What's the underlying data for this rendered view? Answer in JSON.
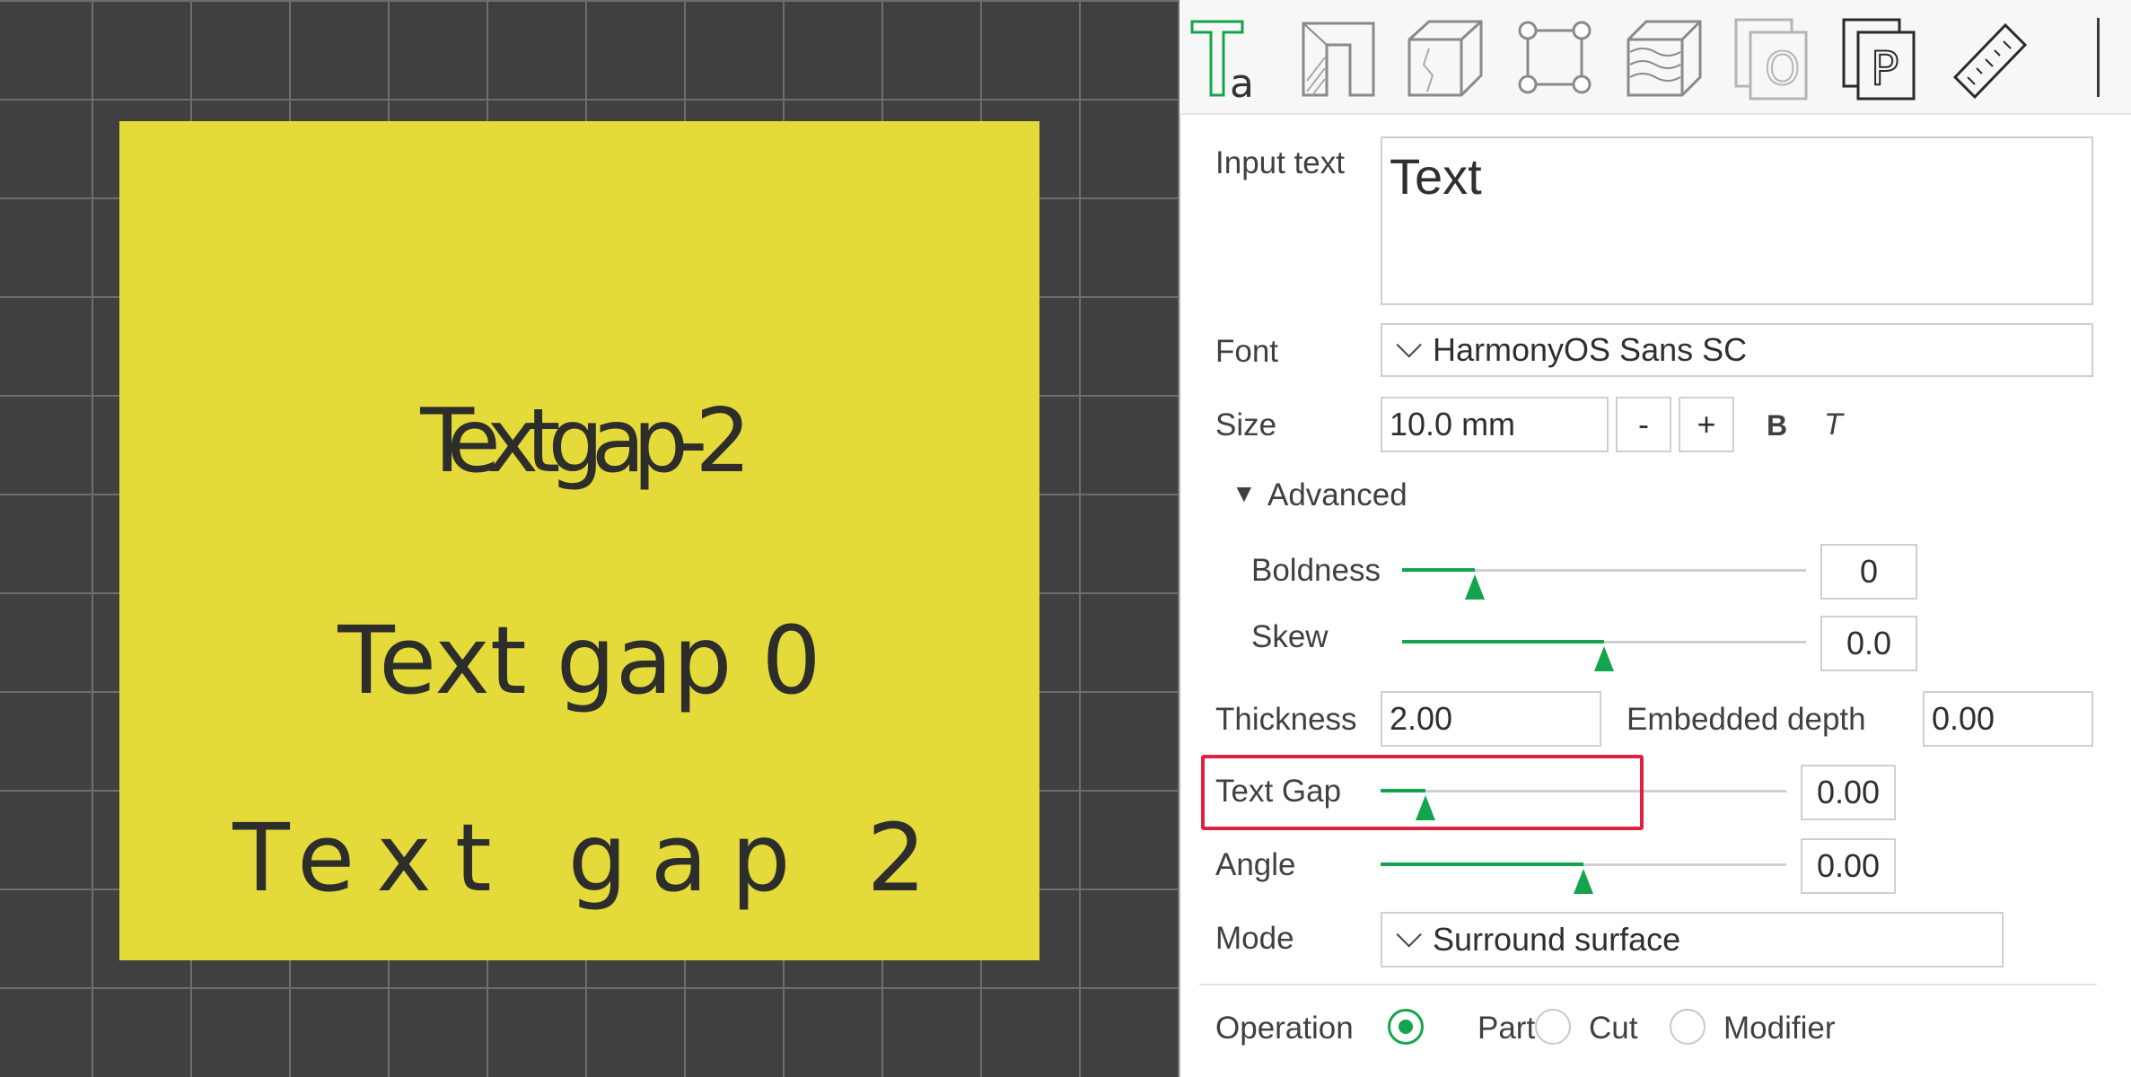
{
  "viewport": {
    "plate_color": "#e4da3a",
    "samples": [
      "Textgap-2",
      "Text gap 0",
      "Text gap 2"
    ]
  },
  "toolbar": {
    "icons": [
      "text-tool-icon",
      "cross-section-icon",
      "cube-icon",
      "bounding-box-icon",
      "layers-icon",
      "copy-icon",
      "paste-icon",
      "ruler-icon"
    ],
    "text_icon_letter": "T",
    "text_icon_sub": "a",
    "paste_letter": "P",
    "copy_letter": "O"
  },
  "form": {
    "input_text_label": "Input text",
    "input_text_value": "Text",
    "font_label": "Font",
    "font_value": "HarmonyOS Sans SC",
    "size_label": "Size",
    "size_value": "10.0 mm",
    "minus": "-",
    "plus": "+",
    "bold": "B",
    "italic": "T",
    "advanced_label": "Advanced",
    "boldness_label": "Boldness",
    "boldness_value": "0",
    "boldness_level": 0.18,
    "skew_label": "Skew",
    "skew_value": "0.0",
    "skew_level": 0.5,
    "thickness_label": "Thickness",
    "thickness_value": "2.00",
    "embedded_label": "Embedded depth",
    "embedded_value": "0.00",
    "text_gap_label": "Text Gap",
    "text_gap_value": "0.00",
    "text_gap_level": 0.11,
    "angle_label": "Angle",
    "angle_value": "0.00",
    "angle_level": 0.5,
    "mode_label": "Mode",
    "mode_value": "Surround surface",
    "operation_label": "Operation",
    "operations": [
      "Part",
      "Cut",
      "Modifier"
    ],
    "operation_selected": "Part"
  },
  "colors": {
    "accent": "#14a44d",
    "highlight": "#e0213f",
    "grid_background": "#404040"
  }
}
